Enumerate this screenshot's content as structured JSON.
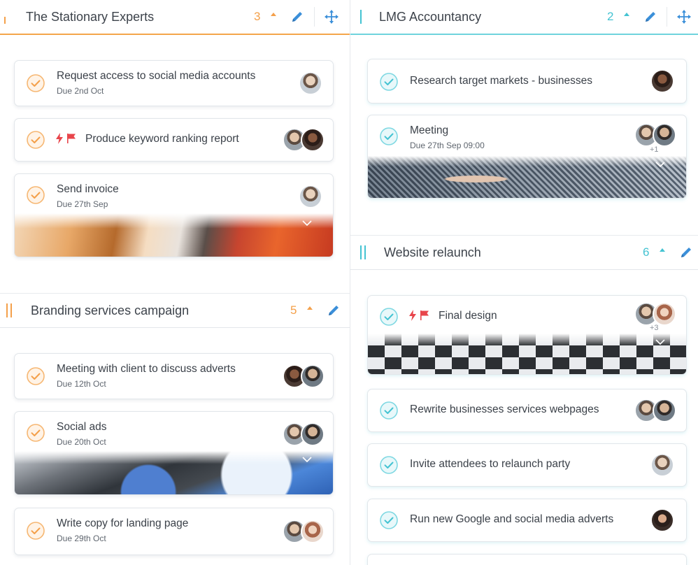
{
  "colors": {
    "orange": "#f4a04a",
    "cyan": "#44c3d2",
    "blue": "#3b8fd9",
    "flag": "#e8454b"
  },
  "left_column": {
    "group1": {
      "title": "The Stationary Experts",
      "count": "3",
      "tasks": [
        {
          "title": "Request access to social media accounts",
          "due": "Due 2nd Oct"
        },
        {
          "title": "Produce keyword ranking report",
          "due": ""
        },
        {
          "title": "Send invoice",
          "due": "Due 27th Sep"
        }
      ]
    },
    "group2": {
      "title": "Branding services campaign",
      "count": "5",
      "tasks": [
        {
          "title": "Meeting with client to discuss adverts",
          "due": "Due 12th Oct"
        },
        {
          "title": "Social ads",
          "due": "Due 20th Oct"
        },
        {
          "title": "Write copy for landing page",
          "due": "Due 29th Oct"
        }
      ]
    }
  },
  "right_column": {
    "group1": {
      "title": "LMG Accountancy",
      "count": "2",
      "tasks": [
        {
          "title": "Research target markets - businesses",
          "due": ""
        },
        {
          "title": "Meeting",
          "due": "Due 27th Sep 09:00",
          "extra_assignees": "+1"
        }
      ]
    },
    "group2": {
      "title": "Website relaunch",
      "count": "6",
      "tasks": [
        {
          "title": "Final design",
          "due": "",
          "extra_assignees": "+3"
        },
        {
          "title": "Rewrite businesses services webpages",
          "due": ""
        },
        {
          "title": "Invite attendees to relaunch party",
          "due": ""
        },
        {
          "title": "Run new Google and social media adverts",
          "due": ""
        }
      ]
    }
  },
  "icons": {
    "collapse": "caret-up-icon",
    "edit": "pencil-icon",
    "move": "move-arrows-icon",
    "complete": "check-circle-icon",
    "urgent": "lightning-icon",
    "flag": "flag-icon",
    "drag": "drag-handle-icon",
    "expand": "chevron-down-icon"
  }
}
